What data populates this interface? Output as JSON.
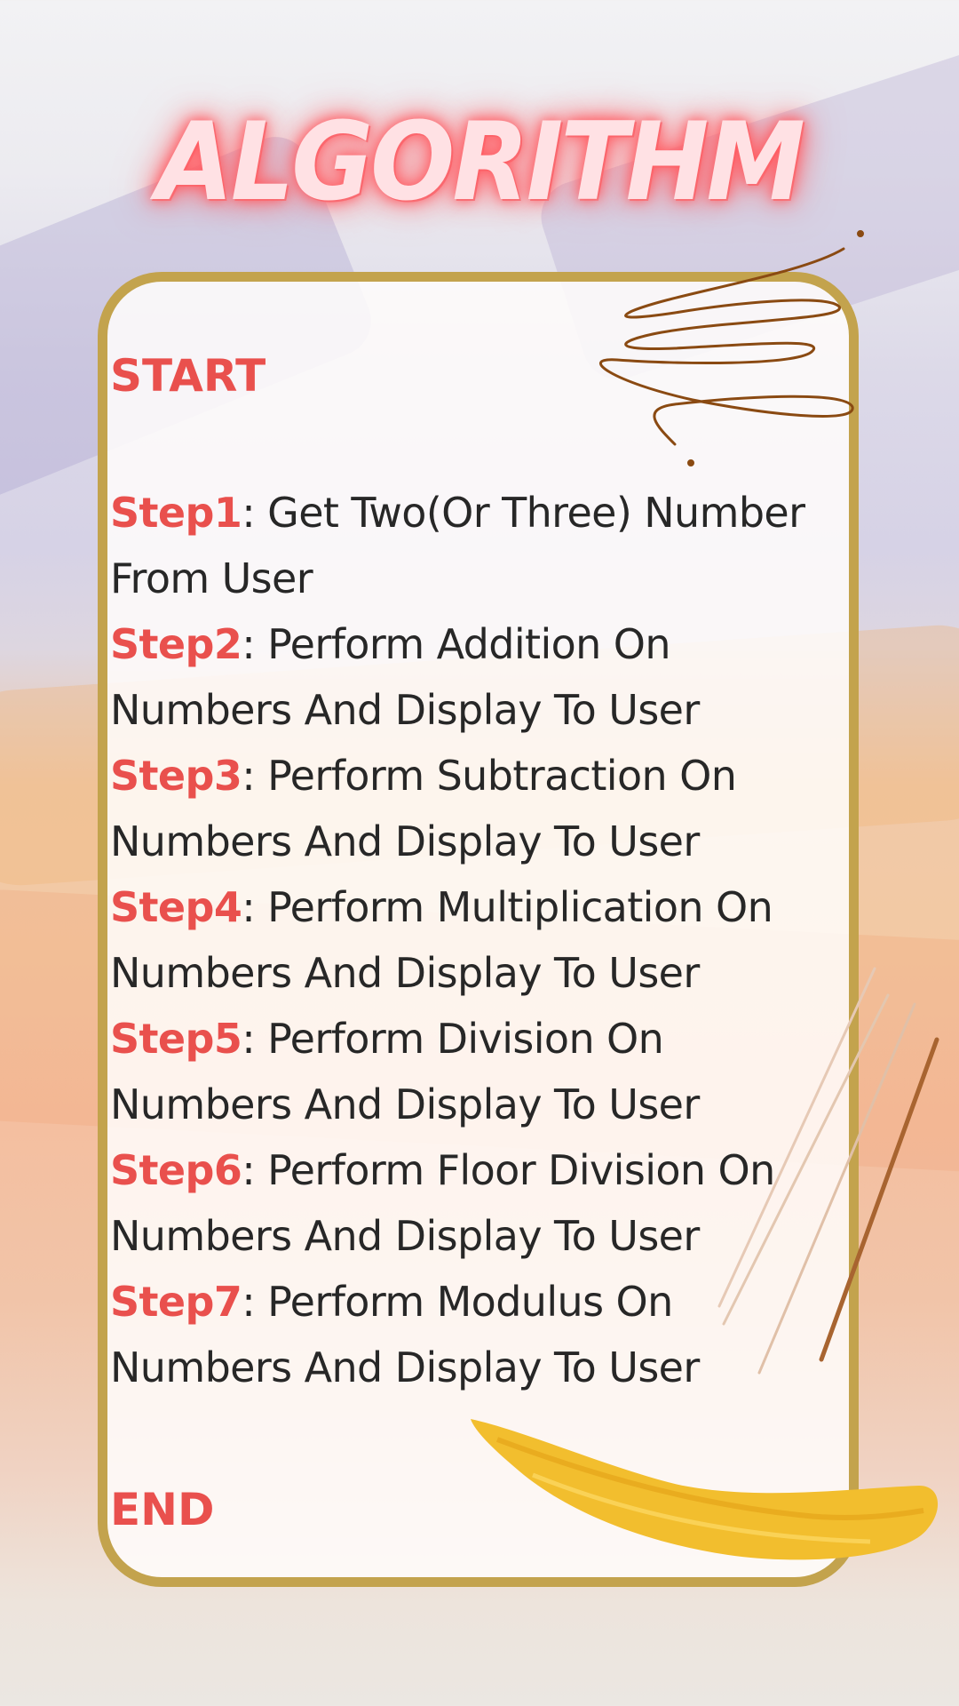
{
  "title": "ALGORITHM",
  "start_label": "START",
  "end_label": "END",
  "steps": [
    {
      "label": "Step1",
      "text": ": Get Two(Or Three) Number From User"
    },
    {
      "label": "Step2",
      "text": ": Perform Addition  On Numbers And Display To User"
    },
    {
      "label": "Step3",
      "text": ": Perform Subtraction On Numbers  And Display To User"
    },
    {
      "label": "Step4",
      "text": ": Perform Multiplication On Numbers And Display To User"
    },
    {
      "label": "Step5",
      "text": ": Perform Division On Numbers And Display To User"
    },
    {
      "label": "Step6",
      "text": ": Perform Floor Division On Numbers And Display To User"
    },
    {
      "label": "Step7",
      "text": ": Perform Modulus On Numbers And Display To User"
    }
  ],
  "colors": {
    "accent": "#e9504d",
    "frame": "#c3a34d",
    "body_text": "#272727",
    "scribble": "#8a4a12",
    "brush": "#f2be2e"
  }
}
